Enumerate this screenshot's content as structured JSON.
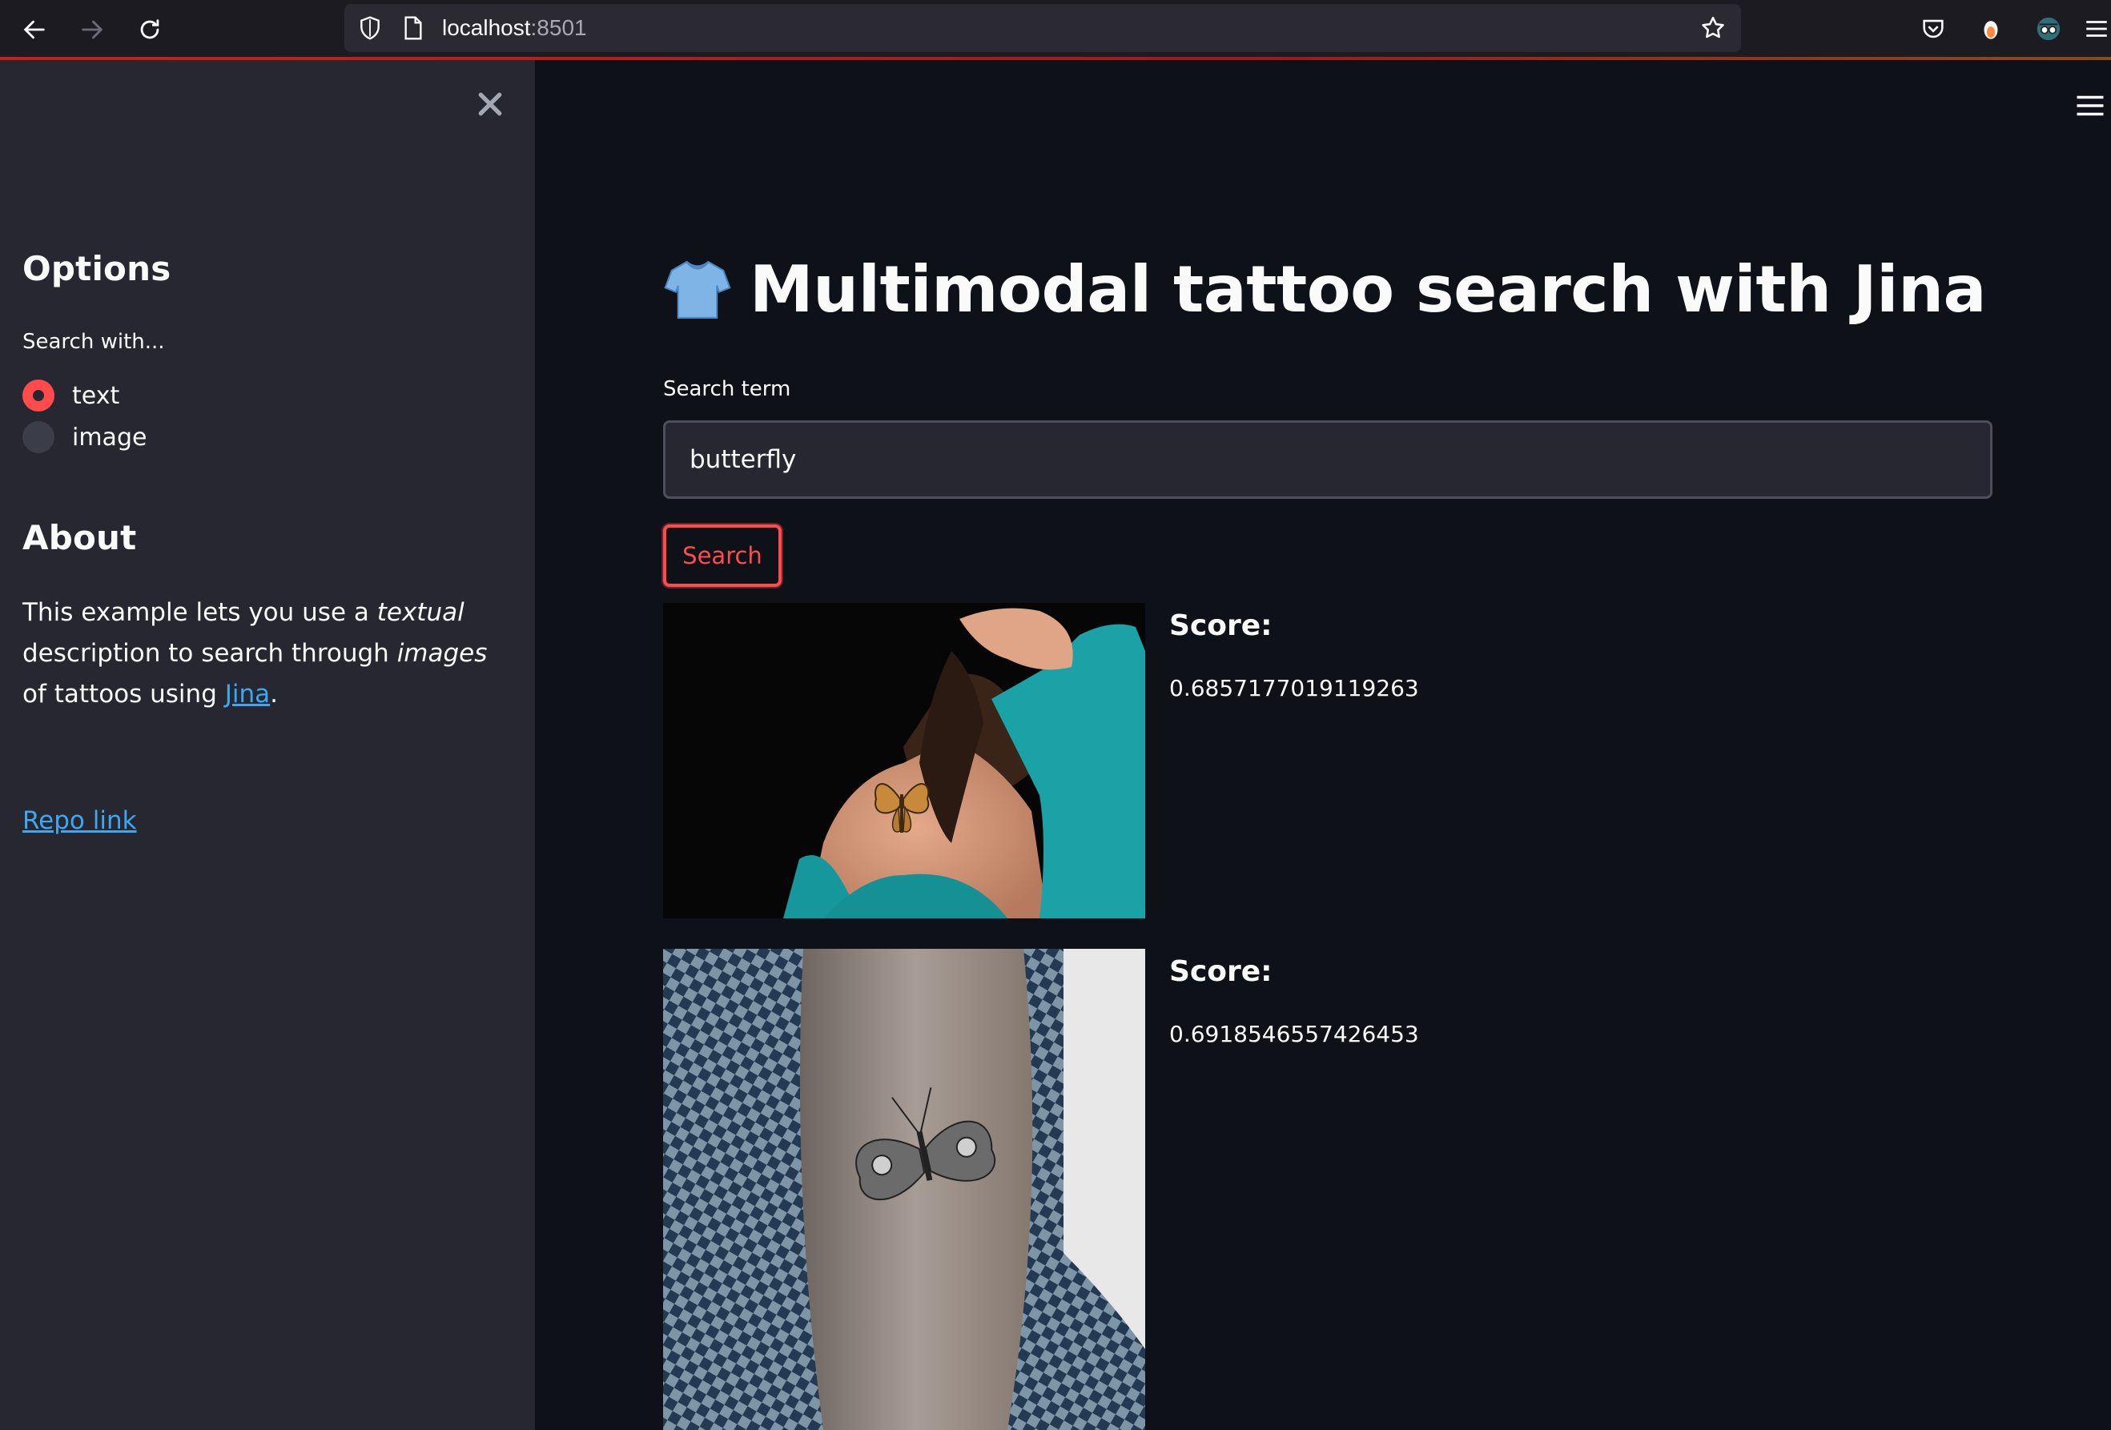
{
  "browser": {
    "url_host": "localhost",
    "url_port": ":8501"
  },
  "sidebar": {
    "options_heading": "Options",
    "search_with_label": "Search with...",
    "radio_options": [
      {
        "label": "text",
        "checked": true
      },
      {
        "label": "image",
        "checked": false
      }
    ],
    "about_heading": "About",
    "about": {
      "p1": "This example lets you use a ",
      "em1": "textual",
      "p2": " description to search through ",
      "em2": "images",
      "p3": " of tattoos using ",
      "link": "Jina",
      "p4": "."
    },
    "repo_link": "Repo link"
  },
  "main": {
    "title": "Multimodal tattoo search with Jina",
    "title_icon": "t-shirt-emoji",
    "search_label": "Search term",
    "search_value": "butterfly",
    "search_button": "Search",
    "results": [
      {
        "score_label": "Score:",
        "score": "0.6857177019119263",
        "image": "woman-back-butterfly-tattoo"
      },
      {
        "score_label": "Score:",
        "score": "0.6918546557426453",
        "image": "forearm-butterfly-tattoo"
      }
    ]
  },
  "colors": {
    "accent": "#ff4b4b",
    "background": "#0e1117",
    "sidebar": "#262730",
    "link": "#3da8f0"
  }
}
